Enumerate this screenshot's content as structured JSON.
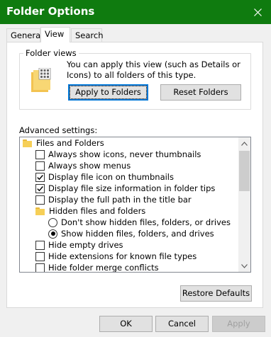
{
  "window": {
    "title": "Folder Options"
  },
  "tabs": [
    {
      "label": "General"
    },
    {
      "label": "View"
    },
    {
      "label": "Search"
    }
  ],
  "folder_views": {
    "group_label": "Folder views",
    "description": "You can apply this view (such as Details or Icons) to all folders of this type.",
    "apply_button": "Apply to Folders",
    "reset_button": "Reset Folders"
  },
  "advanced": {
    "label": "Advanced settings:",
    "items": [
      {
        "type": "folder",
        "label": "Files and Folders"
      },
      {
        "type": "checkbox",
        "label": "Always show icons, never thumbnails",
        "checked": false
      },
      {
        "type": "checkbox",
        "label": "Always show menus",
        "checked": false
      },
      {
        "type": "checkbox",
        "label": "Display file icon on thumbnails",
        "checked": true
      },
      {
        "type": "checkbox",
        "label": "Display file size information in folder tips",
        "checked": true
      },
      {
        "type": "checkbox",
        "label": "Display the full path in the title bar",
        "checked": false
      },
      {
        "type": "folder",
        "label": "Hidden files and folders"
      },
      {
        "type": "radio",
        "label": "Don't show hidden files, folders, or drives",
        "checked": false
      },
      {
        "type": "radio",
        "label": "Show hidden files, folders, and drives",
        "checked": true
      },
      {
        "type": "checkbox",
        "label": "Hide empty drives",
        "checked": false
      },
      {
        "type": "checkbox",
        "label": "Hide extensions for known file types",
        "checked": false
      },
      {
        "type": "checkbox",
        "label": "Hide folder merge conflicts",
        "checked": false
      }
    ]
  },
  "restore_defaults_button": "Restore Defaults",
  "footer": {
    "ok": "OK",
    "cancel": "Cancel",
    "apply": "Apply"
  },
  "colors": {
    "title_bar": "#0f7b0f",
    "focus": "#0078d7"
  },
  "icons": [
    "close-icon",
    "folder-views-icon",
    "folder-icon",
    "checkmark-icon",
    "scroll-up-icon",
    "scroll-down-icon"
  ]
}
